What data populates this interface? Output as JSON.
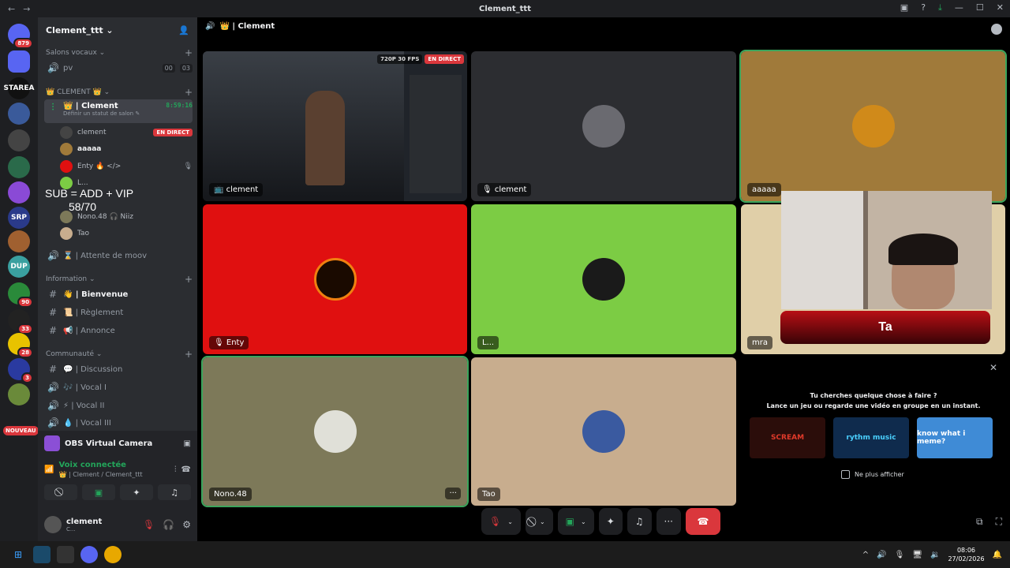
{
  "window": {
    "title": "Clement_ttt",
    "nav_back": "←",
    "nav_fwd": "→"
  },
  "guild": {
    "name": "Clement_ttt ⌄"
  },
  "rail": [
    {
      "label": "",
      "badge": "879"
    },
    {
      "label": "",
      "badge": ""
    },
    {
      "label": "STAREA",
      "badge": ""
    },
    {
      "label": "",
      "badge": ""
    },
    {
      "label": "",
      "badge": ""
    },
    {
      "label": "",
      "badge": ""
    },
    {
      "label": "",
      "badge": ""
    },
    {
      "label": "SRP",
      "badge": ""
    },
    {
      "label": "",
      "badge": ""
    },
    {
      "label": "DUP",
      "badge": ""
    },
    {
      "label": "",
      "badge": "90"
    },
    {
      "label": "",
      "badge": "33"
    },
    {
      "label": "",
      "badge": "28"
    },
    {
      "label": "",
      "badge": "3"
    },
    {
      "label": "",
      "badge": ""
    }
  ],
  "rail_new": "NOUVEAU",
  "categories": {
    "salons_vocaux": "Salons vocaux ⌄",
    "clement": "👑 CLEMENT 👑 ⌄",
    "information": "Information ⌄",
    "communaute": "Communauté ⌄"
  },
  "channels": {
    "pv": {
      "name": "pv",
      "count_a": "00",
      "count_b": "03"
    },
    "clement_voice": {
      "name": "👑 | Clement",
      "timer": "8:59:16",
      "status": "Définir un statut de salon ✎"
    },
    "attente": "⌛ | Attente de moov",
    "bienvenue": "👋 | Bienvenue",
    "reglement": "📜 | Règlement",
    "annonce": "📢 | Annonce",
    "discussion": "💬 | Discussion",
    "vocal1": "🎶 | Vocal I",
    "vocal2": "⚡ | Vocal II",
    "vocal3": "💧 | Vocal III"
  },
  "members": [
    {
      "name": "clement",
      "tag": "EN DIRECT"
    },
    {
      "name": "aaaaa",
      "tag": ""
    },
    {
      "name": "Enty 🔥 </>",
      "tag": ""
    },
    {
      "name": "L...",
      "tag": ""
    },
    {
      "name": "Nono.48 🎧 Niiz",
      "tag": ""
    },
    {
      "name": "Tao",
      "tag": ""
    }
  ],
  "overlay": {
    "line1": "SUB = ADD + VIP",
    "line2": "58/70"
  },
  "panel": {
    "obs": "OBS Virtual Camera",
    "voice_title": "Voix connectée",
    "voice_sub": "👑 | Clement / Clement_ttt",
    "user": "clement",
    "user_status": "C..."
  },
  "stage": {
    "header": "👑 | Clement",
    "stream_quality": "720P 30 FPS",
    "stream_live": "EN DIRECT",
    "tiles": [
      {
        "label": "📺 clement",
        "color": "#20242a"
      },
      {
        "label": "🎙 clement",
        "color": "#2c2d31"
      },
      {
        "label": "aaaaa",
        "color": "#a07a3a"
      },
      {
        "label": "🎙 Enty",
        "color": "#e01010"
      },
      {
        "label": "L...",
        "color": "#7ccc44"
      },
      {
        "label": "mra",
        "color": "#e0cfa8"
      },
      {
        "label": "Nono.48",
        "color": "#7d7959"
      },
      {
        "label": "Tao",
        "color": "#c8ad8e"
      }
    ],
    "more": "···"
  },
  "cam_banner": "Ta",
  "activity": {
    "line1": "Tu cherches quelque chose à faire ?",
    "line2": "Lance un jeu ou regarde une vidéo en groupe en un instant.",
    "games": [
      {
        "name": "SCREAM",
        "color": "#2b0d0a"
      },
      {
        "name": "rythm music",
        "color": "#0f2b4d"
      },
      {
        "name": "know what i meme?",
        "color": "#3f8bd6"
      }
    ],
    "dont_show": "Ne plus afficher"
  },
  "taskbar": {
    "time": "08:06",
    "date": "27/02/2026"
  }
}
